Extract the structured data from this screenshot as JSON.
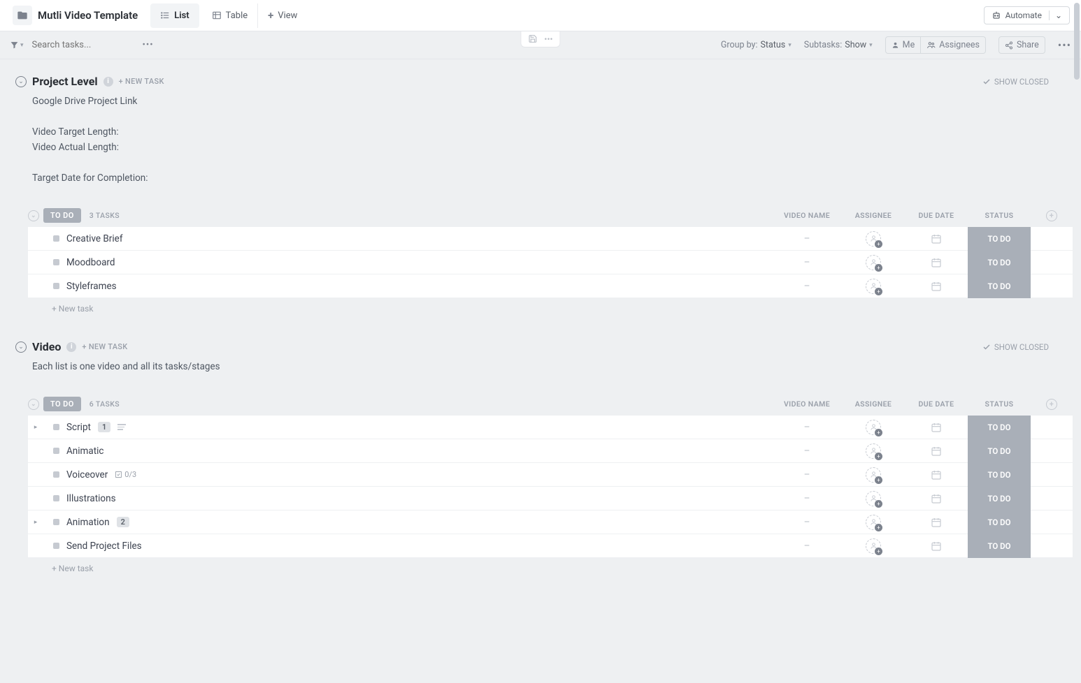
{
  "header": {
    "title": "Mutli Video Template",
    "tabs": {
      "list": "List",
      "table": "Table",
      "view": "View"
    },
    "automate": "Automate"
  },
  "toolbar": {
    "search_placeholder": "Search tasks...",
    "group_by_label": "Group by:",
    "group_by_value": "Status",
    "subtasks_label": "Subtasks:",
    "subtasks_value": "Show",
    "me": "Me",
    "assignees": "Assignees",
    "share": "Share"
  },
  "common": {
    "new_task_upper": "+ NEW TASK",
    "show_closed": "SHOW CLOSED",
    "new_task_lower": "+ New task",
    "columns": {
      "video_name": "VIDEO NAME",
      "assignee": "ASSIGNEE",
      "due_date": "DUE DATE",
      "status": "STATUS"
    }
  },
  "sections": [
    {
      "title": "Project Level",
      "description_lines": [
        "Google Drive Project Link",
        "",
        "Video Target Length:",
        "Video Actual Length:",
        "",
        "Target Date for Completion:"
      ],
      "group": {
        "status_label": "TO DO",
        "count_label": "3 TASKS"
      },
      "tasks": [
        {
          "name": "Creative Brief",
          "status": "TO DO",
          "video_name": "–"
        },
        {
          "name": "Moodboard",
          "status": "TO DO",
          "video_name": "–"
        },
        {
          "name": "Styleframes",
          "status": "TO DO",
          "video_name": "–"
        }
      ]
    },
    {
      "title": "Video",
      "description_lines": [
        "Each list is one video and all its tasks/stages"
      ],
      "group": {
        "status_label": "TO DO",
        "count_label": "6 TASKS"
      },
      "tasks": [
        {
          "name": "Script",
          "status": "TO DO",
          "video_name": "–",
          "expand": true,
          "badge": "1",
          "has_desc": true
        },
        {
          "name": "Animatic",
          "status": "TO DO",
          "video_name": "–"
        },
        {
          "name": "Voiceover",
          "status": "TO DO",
          "video_name": "–",
          "checklist": "0/3"
        },
        {
          "name": "Illustrations",
          "status": "TO DO",
          "video_name": "–"
        },
        {
          "name": "Animation",
          "status": "TO DO",
          "video_name": "–",
          "expand": true,
          "badge": "2"
        },
        {
          "name": "Send Project Files",
          "status": "TO DO",
          "video_name": "–"
        }
      ]
    }
  ]
}
